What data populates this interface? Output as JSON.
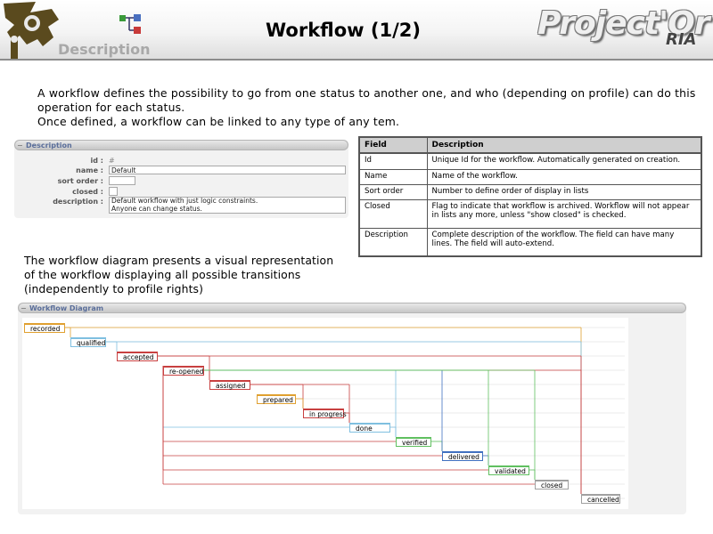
{
  "header": {
    "section_label": "Description",
    "title": "Workflow (1/2)",
    "brand": "Project'Or",
    "brand_suffix": "RIA",
    "icons": {
      "emblem": "gear-emblem-icon",
      "workflow": "workflow-icon"
    }
  },
  "intro": {
    "line1": "A workflow defines the possibility to go from one status to another one, and who (depending on profile) can do this operation for each status.",
    "line2": "Once defined, a workflow can be linked to any type of any tem."
  },
  "description_panel": {
    "title": "Description",
    "toggle": "−",
    "fields": {
      "id_label": "id :",
      "id_value": "# 1",
      "name_label": "name :",
      "name_value": "Default",
      "sort_label": "sort order :",
      "sort_value": "",
      "closed_label": "closed :",
      "description_label": "description :",
      "description_line1": "Default workflow with just logic constraints.",
      "description_line2": "Anyone can change status."
    }
  },
  "field_table": {
    "headers": [
      "Field",
      "Description"
    ],
    "rows": [
      [
        "Id",
        "Unique Id for the workflow. Automatically generated on creation."
      ],
      [
        "Name",
        "Name of the workflow."
      ],
      [
        "Sort order",
        "Number to define order of display in lists"
      ],
      [
        "Closed",
        "Flag to indicate that workflow is archived. Workflow will not appear in lists any more, unless \"show closed\" is checked."
      ],
      [
        "Description",
        "Complete description of the workflow. The field can have many lines. The field will auto-extend."
      ]
    ]
  },
  "diagram_text": "The workflow diagram presents a visual representation of the workflow displaying all possible transitions (independently to profile rights)",
  "diagram_panel": {
    "title": "Workflow Diagram",
    "toggle": "−",
    "statuses": [
      {
        "label": "recorded",
        "color": "#e0a030"
      },
      {
        "label": "qualified",
        "color": "#7fbfe0"
      },
      {
        "label": "accepted",
        "color": "#c84040"
      },
      {
        "label": "re-opened",
        "color": "#c84040"
      },
      {
        "label": "assigned",
        "color": "#c84040"
      },
      {
        "label": "prepared",
        "color": "#e0a030"
      },
      {
        "label": "in progress",
        "color": "#c84040"
      },
      {
        "label": "done",
        "color": "#7fbfe0"
      },
      {
        "label": "verified",
        "color": "#60c060"
      },
      {
        "label": "delivered",
        "color": "#4070c0"
      },
      {
        "label": "validated",
        "color": "#60c060"
      },
      {
        "label": "closed",
        "color": "#a0a0a0"
      },
      {
        "label": "cancelled",
        "color": "#a0a0a0"
      }
    ]
  }
}
